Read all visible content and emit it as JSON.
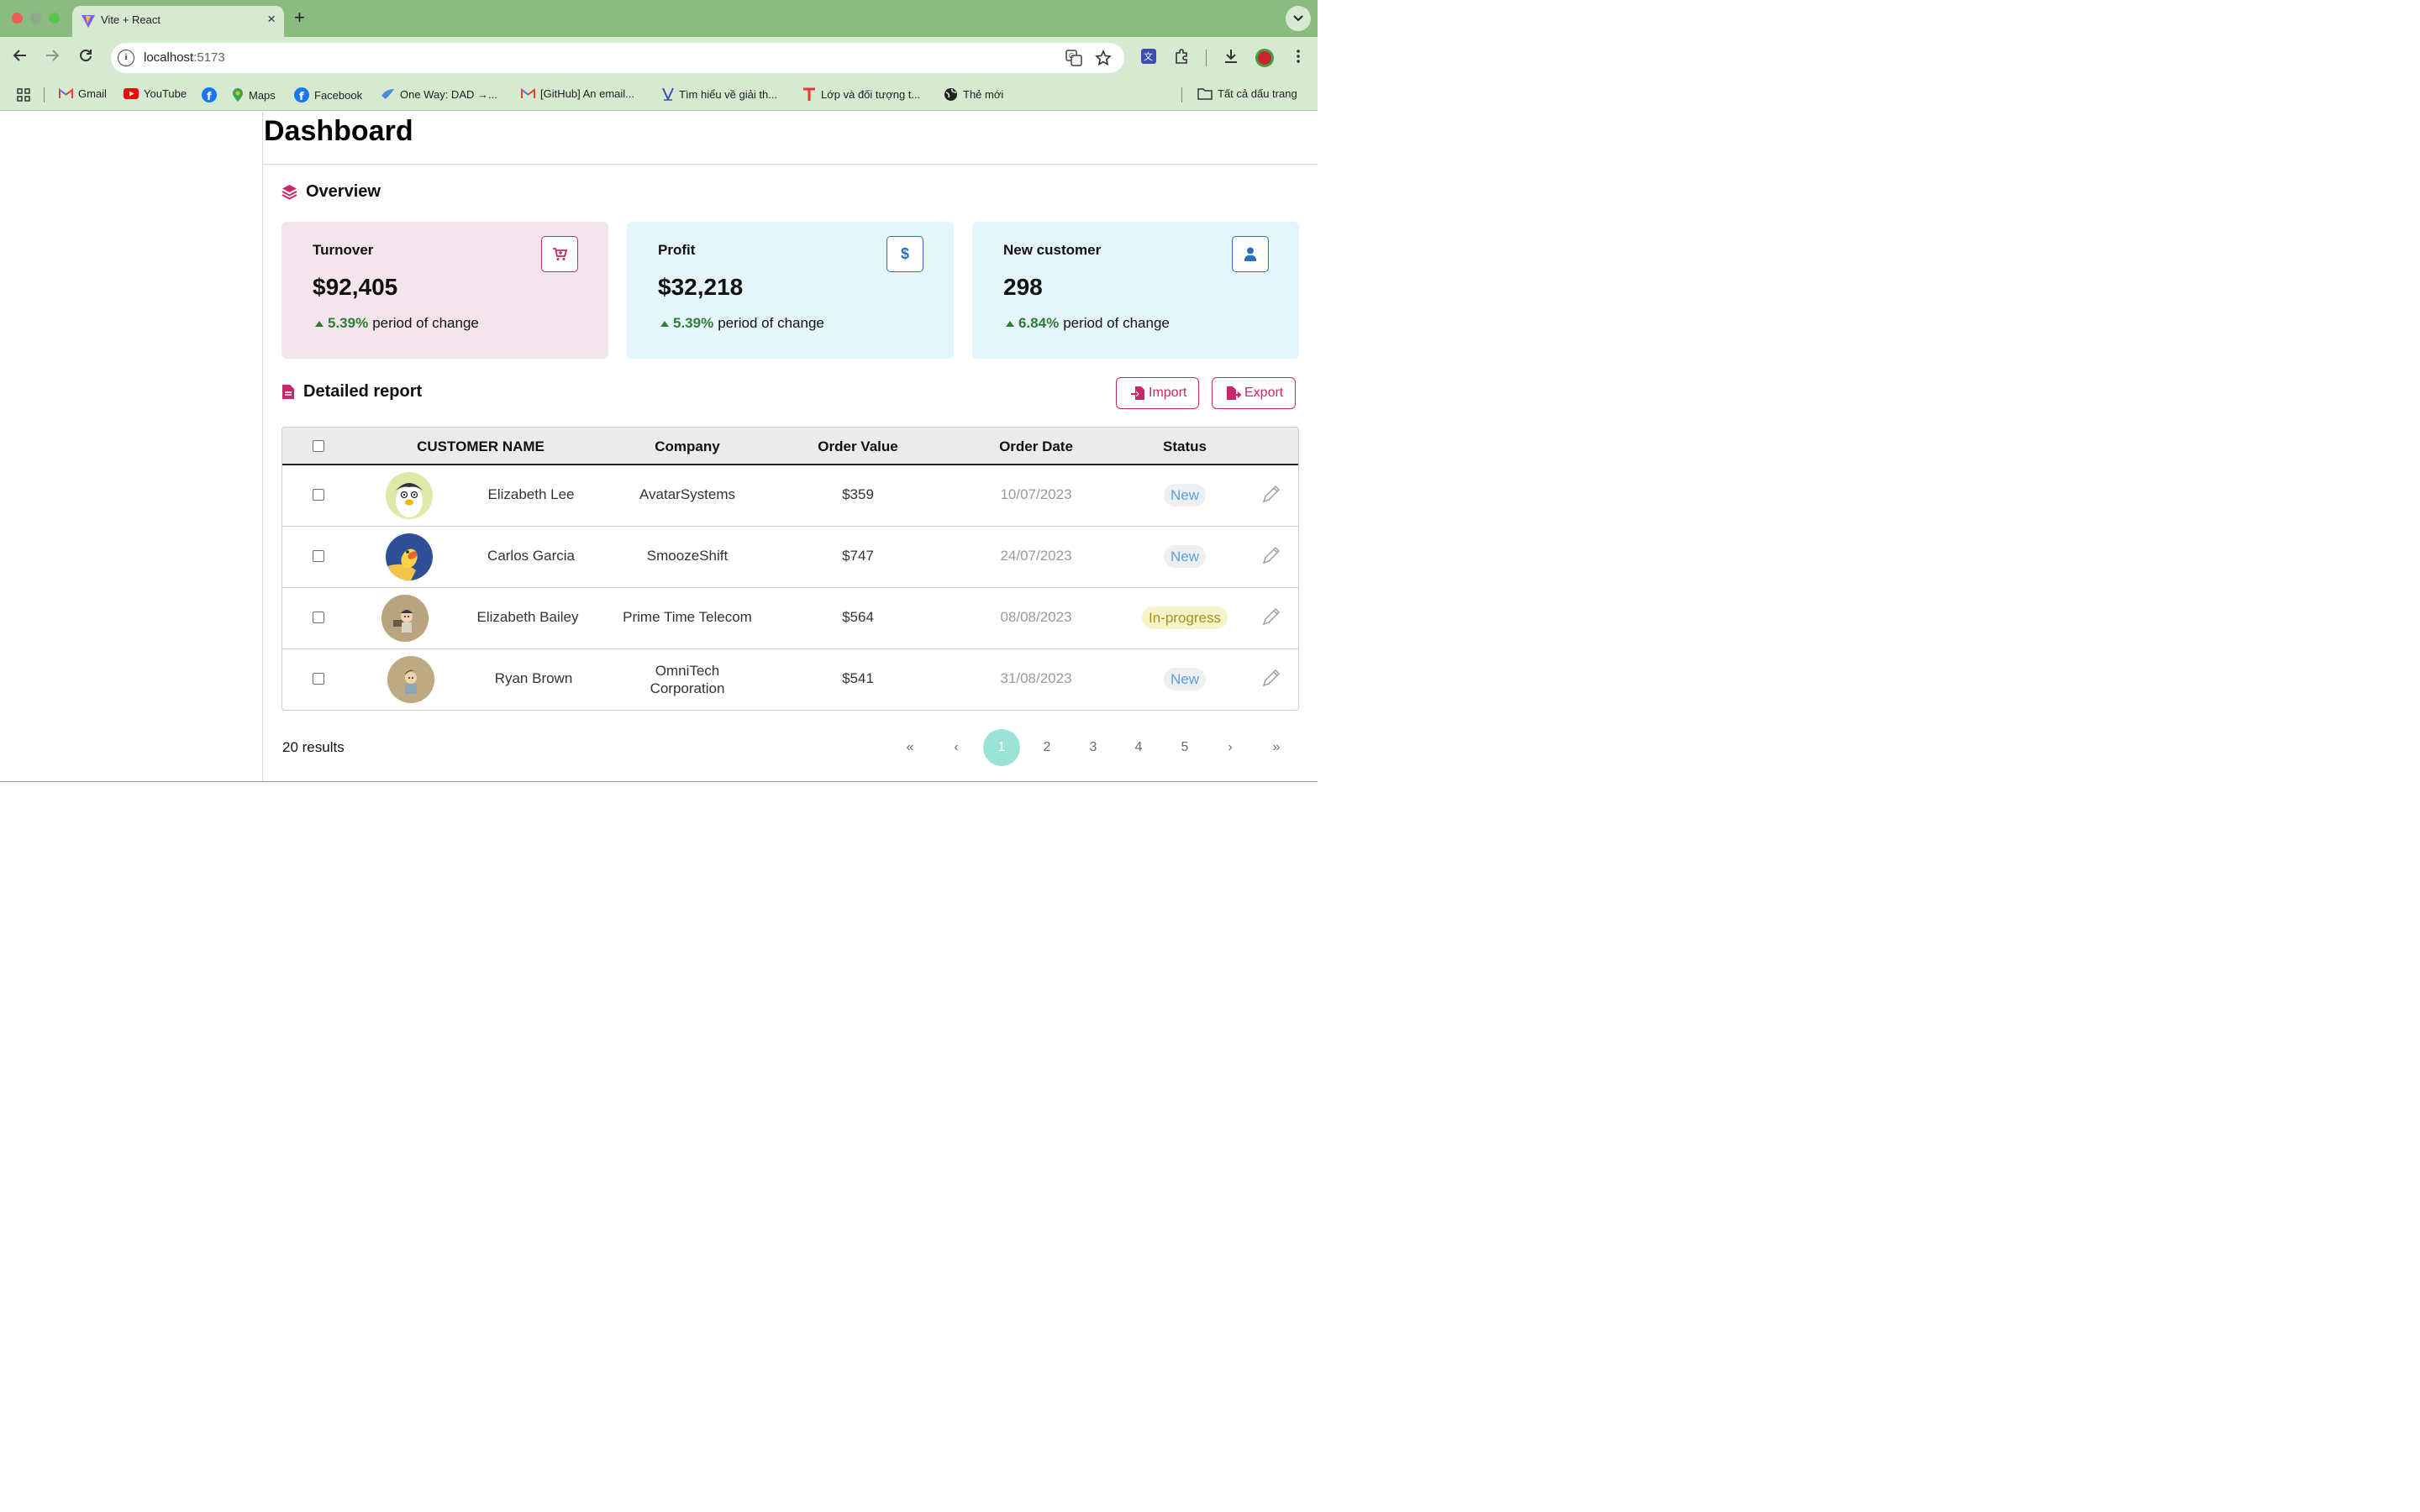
{
  "browser": {
    "tab_title": "Vite + React",
    "url_host": "localhost",
    "url_port": ":5173",
    "bookmarks": [
      {
        "label": "Gmail",
        "icon": "gmail-icon"
      },
      {
        "label": "YouTube",
        "icon": "youtube-icon"
      },
      {
        "label": "",
        "icon": "facebook-icon"
      },
      {
        "label": "Maps",
        "icon": "maps-icon"
      },
      {
        "label": "Facebook",
        "icon": "facebook-icon"
      },
      {
        "label": "One Way: DAD →...",
        "icon": "bird-icon"
      },
      {
        "label": "[GitHub] An email...",
        "icon": "gmail-icon"
      },
      {
        "label": "Tìm hiểu về giải th...",
        "icon": "v-icon"
      },
      {
        "label": "Lớp và đối tượng t...",
        "icon": "t-icon"
      },
      {
        "label": "Thẻ mới",
        "icon": "globe-icon"
      }
    ],
    "all_bookmarks": "Tất cả dấu trang"
  },
  "page": {
    "title": "Dashboard"
  },
  "overview": {
    "title": "Overview",
    "cards": [
      {
        "label": "Turnover",
        "value": "$92,405",
        "change": "5.39%",
        "change_text": "period of change",
        "icon": "cart-icon"
      },
      {
        "label": "Profit",
        "value": "$32,218",
        "change": "5.39%",
        "change_text": "period of change",
        "icon": "dollar-icon"
      },
      {
        "label": "New customer",
        "value": "298",
        "change": "6.84%",
        "change_text": "period of change",
        "icon": "user-icon"
      }
    ]
  },
  "report": {
    "title": "Detailed report",
    "import_label": "Import",
    "export_label": "Export",
    "columns": [
      "CUSTOMER NAME",
      "Company",
      "Order Value",
      "Order Date",
      "Status"
    ],
    "rows": [
      {
        "name": "Elizabeth Lee",
        "company": "AvatarSystems",
        "value": "$359",
        "date": "10/07/2023",
        "status": "New"
      },
      {
        "name": "Carlos Garcia",
        "company": "SmoozeShift",
        "value": "$747",
        "date": "24/07/2023",
        "status": "New"
      },
      {
        "name": "Elizabeth Bailey",
        "company": "Prime Time Telecom",
        "value": "$564",
        "date": "08/08/2023",
        "status": "In-progress"
      },
      {
        "name": "Ryan Brown",
        "company": "OmniTech Corporation",
        "value": "$541",
        "date": "31/08/2023",
        "status": "New"
      }
    ],
    "results": "20 results",
    "pagination": {
      "first": "«",
      "prev": "‹",
      "pages": [
        "1",
        "2",
        "3",
        "4",
        "5"
      ],
      "active_page": "1",
      "next": "›",
      "last": "»"
    }
  },
  "colors": {
    "accent": "#c9266b",
    "positive": "#2e7d32",
    "active_page": "#9be3d6"
  }
}
